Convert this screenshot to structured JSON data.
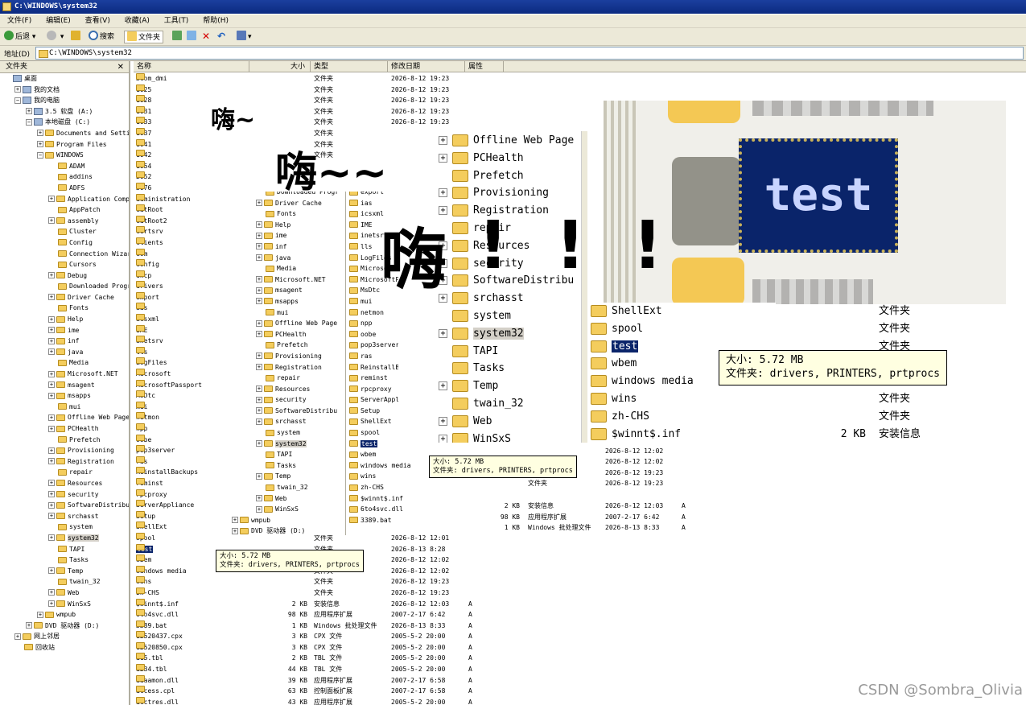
{
  "window": {
    "title": "C:\\WINDOWS\\system32"
  },
  "menu": [
    "文件(F)",
    "编辑(E)",
    "查看(V)",
    "收藏(A)",
    "工具(T)",
    "帮助(H)"
  ],
  "toolbar": {
    "back": "后退",
    "search": "搜索",
    "folders": "文件夹"
  },
  "address": {
    "label": "地址(D)",
    "value": "C:\\WINDOWS\\system32"
  },
  "left_pane": {
    "title": "文件夹",
    "close": "✕"
  },
  "tree": [
    {
      "t": "桌面",
      "i": 0,
      "e": ""
    },
    {
      "t": "我的文档",
      "i": 1,
      "e": "+"
    },
    {
      "t": "我的电脑",
      "i": 1,
      "e": "-"
    },
    {
      "t": "3.5 软盘 (A:)",
      "i": 2,
      "e": "+"
    },
    {
      "t": "本地磁盘 (C:)",
      "i": 2,
      "e": "-"
    },
    {
      "t": "Documents and Setti",
      "i": 3,
      "e": "+"
    },
    {
      "t": "Program Files",
      "i": 3,
      "e": "+"
    },
    {
      "t": "WINDOWS",
      "i": 3,
      "e": "-"
    },
    {
      "t": "ADAM",
      "i": 4,
      "e": ""
    },
    {
      "t": "addins",
      "i": 4,
      "e": ""
    },
    {
      "t": "ADFS",
      "i": 4,
      "e": ""
    },
    {
      "t": "Application Comp",
      "i": 4,
      "e": "+"
    },
    {
      "t": "AppPatch",
      "i": 4,
      "e": ""
    },
    {
      "t": "assembly",
      "i": 4,
      "e": "+"
    },
    {
      "t": "Cluster",
      "i": 4,
      "e": ""
    },
    {
      "t": "Config",
      "i": 4,
      "e": ""
    },
    {
      "t": "Connection Wizar",
      "i": 4,
      "e": ""
    },
    {
      "t": "Cursors",
      "i": 4,
      "e": ""
    },
    {
      "t": "Debug",
      "i": 4,
      "e": "+"
    },
    {
      "t": "Downloaded Progr",
      "i": 4,
      "e": ""
    },
    {
      "t": "Driver Cache",
      "i": 4,
      "e": "+"
    },
    {
      "t": "Fonts",
      "i": 4,
      "e": ""
    },
    {
      "t": "Help",
      "i": 4,
      "e": "+"
    },
    {
      "t": "ime",
      "i": 4,
      "e": "+"
    },
    {
      "t": "inf",
      "i": 4,
      "e": "+"
    },
    {
      "t": "java",
      "i": 4,
      "e": "+"
    },
    {
      "t": "Media",
      "i": 4,
      "e": ""
    },
    {
      "t": "Microsoft.NET",
      "i": 4,
      "e": "+"
    },
    {
      "t": "msagent",
      "i": 4,
      "e": "+"
    },
    {
      "t": "msapps",
      "i": 4,
      "e": "+"
    },
    {
      "t": "mui",
      "i": 4,
      "e": ""
    },
    {
      "t": "Offline Web Page",
      "i": 4,
      "e": "+"
    },
    {
      "t": "PCHealth",
      "i": 4,
      "e": "+"
    },
    {
      "t": "Prefetch",
      "i": 4,
      "e": ""
    },
    {
      "t": "Provisioning",
      "i": 4,
      "e": "+"
    },
    {
      "t": "Registration",
      "i": 4,
      "e": "+"
    },
    {
      "t": "repair",
      "i": 4,
      "e": ""
    },
    {
      "t": "Resources",
      "i": 4,
      "e": "+"
    },
    {
      "t": "security",
      "i": 4,
      "e": "+"
    },
    {
      "t": "SoftwareDistribu",
      "i": 4,
      "e": "+"
    },
    {
      "t": "srchasst",
      "i": 4,
      "e": "+"
    },
    {
      "t": "system",
      "i": 4,
      "e": ""
    },
    {
      "t": "system32",
      "i": 4,
      "e": "+"
    },
    {
      "t": "TAPI",
      "i": 4,
      "e": ""
    },
    {
      "t": "Tasks",
      "i": 4,
      "e": ""
    },
    {
      "t": "Temp",
      "i": 4,
      "e": "+"
    },
    {
      "t": "twain_32",
      "i": 4,
      "e": ""
    },
    {
      "t": "Web",
      "i": 4,
      "e": "+"
    },
    {
      "t": "WinSxS",
      "i": 4,
      "e": "+"
    },
    {
      "t": "wmpub",
      "i": 3,
      "e": "+"
    },
    {
      "t": "DVD 驱动器 (D:)",
      "i": 2,
      "e": "+"
    },
    {
      "t": "网上邻居",
      "i": 1,
      "e": "+"
    },
    {
      "t": "回收站",
      "i": 1,
      "e": ""
    }
  ],
  "columns": [
    "名称",
    "大小",
    "类型",
    "修改日期",
    "属性"
  ],
  "files": [
    {
      "n": "3com_dmi",
      "s": "",
      "t": "文件夹",
      "d": "2026-8-12 19:23",
      "a": ""
    },
    {
      "n": "1025",
      "s": "",
      "t": "文件夹",
      "d": "2026-8-12 19:23",
      "a": ""
    },
    {
      "n": "1028",
      "s": "",
      "t": "文件夹",
      "d": "2026-8-12 19:23",
      "a": ""
    },
    {
      "n": "1031",
      "s": "",
      "t": "文件夹",
      "d": "2026-8-12 19:23",
      "a": ""
    },
    {
      "n": "1033",
      "s": "",
      "t": "文件夹",
      "d": "2026-8-12 19:23",
      "a": ""
    },
    {
      "n": "1037",
      "s": "",
      "t": "文件夹",
      "d": "",
      "a": ""
    },
    {
      "n": "1041",
      "s": "",
      "t": "文件夹",
      "d": "",
      "a": ""
    },
    {
      "n": "1042",
      "s": "",
      "t": "文件夹",
      "d": "",
      "a": ""
    },
    {
      "n": "1054",
      "s": "",
      "t": "",
      "d": "",
      "a": ""
    },
    {
      "n": "2052",
      "s": "",
      "t": "",
      "d": "",
      "a": ""
    },
    {
      "n": "3076",
      "s": "",
      "t": "",
      "d": "",
      "a": ""
    },
    {
      "n": "administration",
      "s": "",
      "t": "",
      "d": "",
      "a": ""
    },
    {
      "n": "CatRoot",
      "s": "",
      "t": "",
      "d": "",
      "a": ""
    },
    {
      "n": "CatRoot2",
      "s": "",
      "t": "",
      "d": "",
      "a": ""
    },
    {
      "n": "certsrv",
      "s": "",
      "t": "",
      "d": "",
      "a": ""
    },
    {
      "n": "clients",
      "s": "",
      "t": "",
      "d": "",
      "a": ""
    },
    {
      "n": "Com",
      "s": "",
      "t": "",
      "d": "",
      "a": ""
    },
    {
      "n": "config",
      "s": "",
      "t": "",
      "d": "",
      "a": ""
    },
    {
      "n": "dhcp",
      "s": "",
      "t": "",
      "d": "",
      "a": ""
    },
    {
      "n": "drivers",
      "s": "",
      "t": "",
      "d": "",
      "a": ""
    },
    {
      "n": "export",
      "s": "",
      "t": "",
      "d": "",
      "a": ""
    },
    {
      "n": "ias",
      "s": "",
      "t": "",
      "d": "",
      "a": ""
    },
    {
      "n": "icsxml",
      "s": "",
      "t": "",
      "d": "",
      "a": ""
    },
    {
      "n": "IME",
      "s": "",
      "t": "",
      "d": "",
      "a": ""
    },
    {
      "n": "inetsrv",
      "s": "",
      "t": "",
      "d": "",
      "a": ""
    },
    {
      "n": "lls",
      "s": "",
      "t": "",
      "d": "",
      "a": ""
    },
    {
      "n": "LogFiles",
      "s": "",
      "t": "",
      "d": "",
      "a": ""
    },
    {
      "n": "Microsoft",
      "s": "",
      "t": "",
      "d": "",
      "a": ""
    },
    {
      "n": "MicrosoftPassport",
      "s": "",
      "t": "",
      "d": "",
      "a": ""
    },
    {
      "n": "MsDtc",
      "s": "",
      "t": "",
      "d": "",
      "a": ""
    },
    {
      "n": "mui",
      "s": "",
      "t": "",
      "d": "",
      "a": ""
    },
    {
      "n": "netmon",
      "s": "",
      "t": "",
      "d": "",
      "a": ""
    },
    {
      "n": "npp",
      "s": "",
      "t": "",
      "d": "",
      "a": ""
    },
    {
      "n": "oobe",
      "s": "",
      "t": "",
      "d": "",
      "a": ""
    },
    {
      "n": "pop3server",
      "s": "",
      "t": "",
      "d": "",
      "a": ""
    },
    {
      "n": "ras",
      "s": "",
      "t": "",
      "d": "",
      "a": ""
    },
    {
      "n": "ReinstallBackups",
      "s": "",
      "t": "",
      "d": "",
      "a": ""
    },
    {
      "n": "reminst",
      "s": "",
      "t": "",
      "d": "",
      "a": ""
    },
    {
      "n": "rpcproxy",
      "s": "",
      "t": "",
      "d": "",
      "a": ""
    },
    {
      "n": "ServerAppliance",
      "s": "",
      "t": "",
      "d": "",
      "a": ""
    },
    {
      "n": "Setup",
      "s": "",
      "t": "",
      "d": "",
      "a": ""
    },
    {
      "n": "ShellExt",
      "s": "",
      "t": "",
      "d": "",
      "a": ""
    },
    {
      "n": "spool",
      "s": "",
      "t": "文件夹",
      "d": "2026-8-12 12:01",
      "a": ""
    },
    {
      "n": "test",
      "s": "",
      "t": "文件夹",
      "d": "2026-8-13 8:28",
      "a": ""
    },
    {
      "n": "wbem",
      "s": "",
      "t": "文件夹",
      "d": "2026-8-12 12:02",
      "a": ""
    },
    {
      "n": "windows media",
      "s": "",
      "t": "文件夹",
      "d": "2026-8-12 12:02",
      "a": ""
    },
    {
      "n": "wins",
      "s": "",
      "t": "文件夹",
      "d": "2026-8-12 19:23",
      "a": ""
    },
    {
      "n": "zh-CHS",
      "s": "",
      "t": "文件夹",
      "d": "2026-8-12 19:23",
      "a": ""
    },
    {
      "n": "$winnt$.inf",
      "s": "2 KB",
      "t": "安装信息",
      "d": "2026-8-12 12:03",
      "a": "A"
    },
    {
      "n": "6to4svc.dll",
      "s": "98 KB",
      "t": "应用程序扩展",
      "d": "2007-2-17 6:42",
      "a": "A"
    },
    {
      "n": "3389.bat",
      "s": "1 KB",
      "t": "Windows 批处理文件",
      "d": "2026-8-13 8:33",
      "a": "A"
    },
    {
      "n": "12520437.cpx",
      "s": "3 KB",
      "t": "CPX 文件",
      "d": "2005-5-2 20:00",
      "a": "A"
    },
    {
      "n": "12520850.cpx",
      "s": "3 KB",
      "t": "CPX 文件",
      "d": "2005-5-2 20:00",
      "a": "A"
    },
    {
      "n": "a15.tbl",
      "s": "2 KB",
      "t": "TBL 文件",
      "d": "2005-5-2 20:00",
      "a": "A"
    },
    {
      "n": "a234.tbl",
      "s": "44 KB",
      "t": "TBL 文件",
      "d": "2005-5-2 20:00",
      "a": "A"
    },
    {
      "n": "aaaamon.dll",
      "s": "39 KB",
      "t": "应用程序扩展",
      "d": "2007-2-17 6:58",
      "a": "A"
    },
    {
      "n": "access.cpl",
      "s": "63 KB",
      "t": "控制面板扩展",
      "d": "2007-2-17 6:58",
      "a": "A"
    },
    {
      "n": "acctres.dll",
      "s": "43 KB",
      "t": "应用程序扩展",
      "d": "2005-5-2 20:00",
      "a": "A"
    }
  ],
  "overlay1_tree": [
    {
      "t": "Downloaded Progr",
      "e": ""
    },
    {
      "t": "Driver Cache",
      "e": "+"
    },
    {
      "t": "Fonts",
      "e": ""
    },
    {
      "t": "Help",
      "e": "+"
    },
    {
      "t": "ime",
      "e": "+"
    },
    {
      "t": "inf",
      "e": "+"
    },
    {
      "t": "java",
      "e": "+"
    },
    {
      "t": "Media",
      "e": ""
    },
    {
      "t": "Microsoft.NET",
      "e": "+"
    },
    {
      "t": "msagent",
      "e": "+"
    },
    {
      "t": "msapps",
      "e": "+"
    },
    {
      "t": "mui",
      "e": ""
    },
    {
      "t": "Offline Web Page",
      "e": "+"
    },
    {
      "t": "PCHealth",
      "e": "+"
    },
    {
      "t": "Prefetch",
      "e": ""
    },
    {
      "t": "Provisioning",
      "e": "+"
    },
    {
      "t": "Registration",
      "e": "+"
    },
    {
      "t": "repair",
      "e": ""
    },
    {
      "t": "Resources",
      "e": "+"
    },
    {
      "t": "security",
      "e": "+"
    },
    {
      "t": "SoftwareDistribu",
      "e": "+"
    },
    {
      "t": "srchasst",
      "e": "+"
    },
    {
      "t": "system",
      "e": ""
    },
    {
      "t": "system32",
      "e": "+"
    },
    {
      "t": "TAPI",
      "e": ""
    },
    {
      "t": "Tasks",
      "e": ""
    },
    {
      "t": "Temp",
      "e": "+"
    },
    {
      "t": "twain_32",
      "e": ""
    },
    {
      "t": "Web",
      "e": "+"
    },
    {
      "t": "WinSxS",
      "e": "+"
    },
    {
      "t": "wmpub",
      "e": "+"
    },
    {
      "t": "DVD 驱动器 (D:)",
      "e": "+"
    }
  ],
  "overlay1_files": [
    "export",
    "ias",
    "icsxml",
    "IME",
    "inetsrv",
    "lls",
    "LogFiles",
    "Microsoft",
    "MicrosoftP",
    "MsDtc",
    "mui",
    "netmon",
    "npp",
    "oobe",
    "pop3server",
    "ras",
    "ReinstallB",
    "reminst",
    "rpcproxy",
    "ServerAppl",
    "Setup",
    "ShellExt",
    "spool",
    "test",
    "wbem",
    "windows media",
    "wins",
    "zh-CHS",
    "$winnt$.inf",
    "6to4svc.dll",
    "3389.bat"
  ],
  "overlay1_details": [
    {
      "s": "2 KB",
      "t": "安装信息",
      "d": "2026-8-12 12:03",
      "a": "A"
    },
    {
      "s": "98 KB",
      "t": "应用程序扩展",
      "d": "2007-2-17 6:42",
      "a": "A"
    },
    {
      "s": "1 KB",
      "t": "Windows 批处理文件",
      "d": "2026-8-13 8:33",
      "a": "A"
    }
  ],
  "overlay1_dates": [
    {
      "t": "",
      "d": "2026-8-13 8:28"
    },
    {
      "t": "",
      "d": "2026-8-12 12:02"
    },
    {
      "t": "",
      "d": "2026-8-12 12:02"
    },
    {
      "t": "文件夹",
      "d": "2026-8-12 19:23"
    },
    {
      "t": "文件夹",
      "d": "2026-8-12 19:23"
    }
  ],
  "overlay2_tree": [
    {
      "t": "Offline Web Page",
      "e": "+"
    },
    {
      "t": "PCHealth",
      "e": "+"
    },
    {
      "t": "Prefetch",
      "e": ""
    },
    {
      "t": "Provisioning",
      "e": "+"
    },
    {
      "t": "Registration",
      "e": "+"
    },
    {
      "t": "repair",
      "e": ""
    },
    {
      "t": "Resources",
      "e": "+"
    },
    {
      "t": "security",
      "e": "+"
    },
    {
      "t": "SoftwareDistribu",
      "e": "+"
    },
    {
      "t": "srchasst",
      "e": "+"
    },
    {
      "t": "system",
      "e": ""
    },
    {
      "t": "system32",
      "e": "+"
    },
    {
      "t": "TAPI",
      "e": ""
    },
    {
      "t": "Tasks",
      "e": ""
    },
    {
      "t": "Temp",
      "e": "+"
    },
    {
      "t": "twain_32",
      "e": ""
    },
    {
      "t": "Web",
      "e": "+"
    },
    {
      "t": "WinSxS",
      "e": "+"
    }
  ],
  "overlay3_files": [
    {
      "n": "ShellExt",
      "s": "",
      "t": "文件夹"
    },
    {
      "n": "spool",
      "s": "",
      "t": "文件夹"
    },
    {
      "n": "test",
      "s": "",
      "t": "文件夹"
    },
    {
      "n": "wbem",
      "s": "",
      "t": ""
    },
    {
      "n": "windows media",
      "s": "",
      "t": ""
    },
    {
      "n": "wins",
      "s": "",
      "t": "文件夹"
    },
    {
      "n": "zh-CHS",
      "s": "",
      "t": "文件夹"
    },
    {
      "n": "$winnt$.inf",
      "s": "2 KB",
      "t": "安装信息"
    }
  ],
  "zoom_label": "test",
  "tooltip": {
    "size": "大小: 5.72 MB",
    "folders": "文件夹: drivers, PRINTERS, prtprocs"
  },
  "overlay_text": {
    "hai1": "嗨~",
    "hai2": "嗨~~",
    "hai3": "嗨",
    "ex1": "!",
    "ex2": "!",
    "ex3": "!"
  },
  "watermark": "CSDN @Sombra_Olivia"
}
